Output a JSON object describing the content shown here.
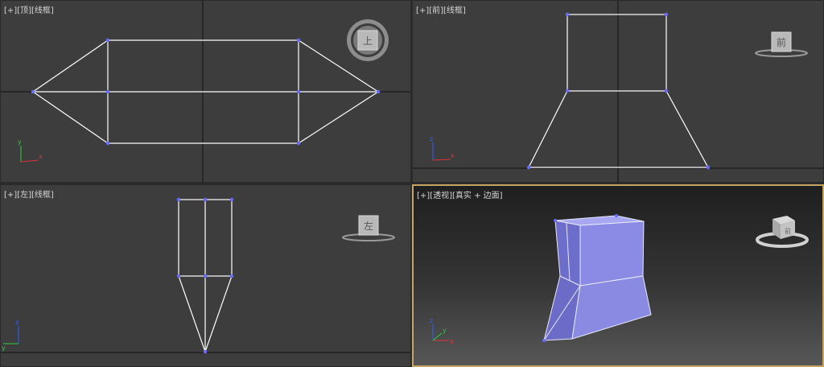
{
  "viewports": {
    "top": {
      "menu": "+",
      "view": "顶",
      "shading": "线框",
      "viewcube_label": "上"
    },
    "front": {
      "menu": "+",
      "view": "前",
      "shading": "线框",
      "viewcube_label": "前"
    },
    "left": {
      "menu": "+",
      "view": "左",
      "shading": "线框",
      "viewcube_label": "左"
    },
    "perspective": {
      "menu": "+",
      "view": "透视",
      "shading": "真实 + 边面",
      "viewcube_label": "前"
    }
  },
  "axis_gizmo": {
    "x": "x",
    "y": "y",
    "z": "z"
  },
  "colors": {
    "viewport_bg": "#3d3d3d",
    "active_border": "#c4a564",
    "wire": "#ffffff",
    "vertex": "#6a6aff",
    "shaded_face": "#8a8ae6"
  },
  "icons": {
    "viewcube": "viewcube-icon",
    "axis": "axis-tripod-icon"
  }
}
